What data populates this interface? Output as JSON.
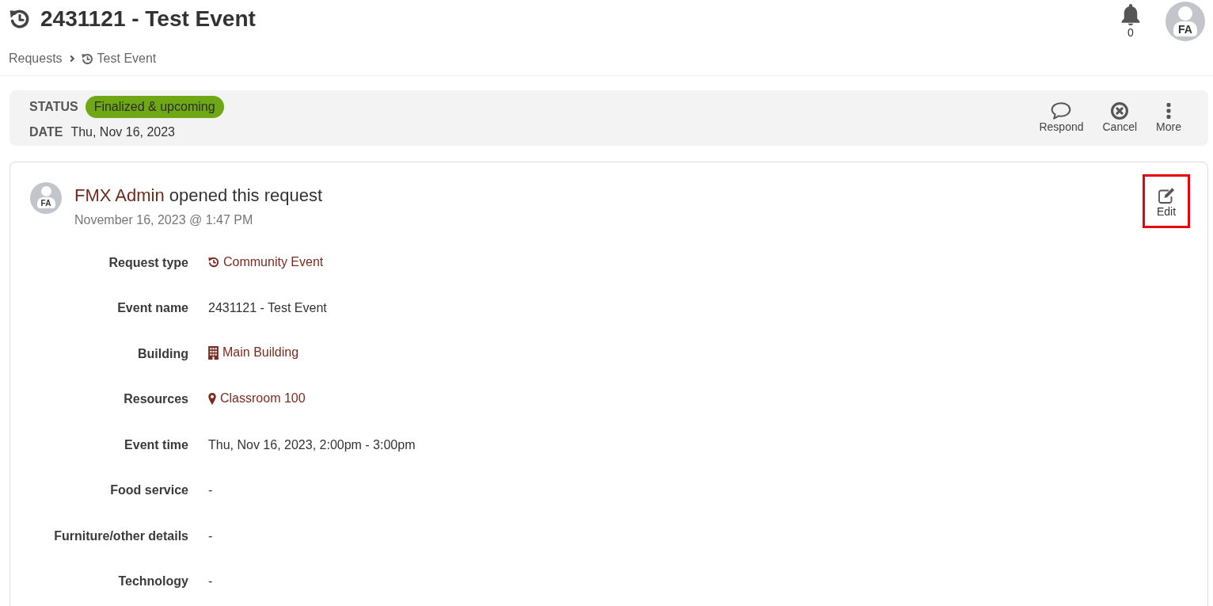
{
  "header": {
    "title": "2431121 - Test Event",
    "notification_count": "0",
    "avatar_initials": "FA"
  },
  "breadcrumb": [
    {
      "label": "Requests",
      "kind": "link"
    },
    {
      "label": "Test Event",
      "kind": "event"
    }
  ],
  "summary": {
    "status_label": "STATUS",
    "status": "Finalized & upcoming",
    "date_label": "DATE",
    "date": "Thu, Nov 16, 2023",
    "actions": [
      {
        "label": "Respond",
        "kind": "respond"
      },
      {
        "label": "Cancel",
        "kind": "cancel"
      },
      {
        "label": "More",
        "kind": "more"
      }
    ]
  },
  "activity": {
    "avatar_initials": "FA",
    "actor": "FMX Admin",
    "action": "opened this request",
    "timestamp": "November 16, 2023 @ 1:47 PM",
    "edit": {
      "label": "Edit",
      "highlighted": true
    },
    "fields": [
      {
        "label": "Request type",
        "value": "Community Event",
        "kind": "event"
      },
      {
        "label": "Event name",
        "value": "2431121 - Test Event",
        "kind": "text"
      },
      {
        "label": "Building",
        "value": "Main Building",
        "kind": "building"
      },
      {
        "label": "Resources",
        "value": "Classroom 100",
        "kind": "location"
      },
      {
        "label": "Event time",
        "value": "Thu, Nov 16, 2023, 2:00pm - 3:00pm",
        "kind": "text"
      },
      {
        "label": "Food service",
        "value": "-",
        "kind": "text"
      },
      {
        "label": "Furniture/other details",
        "value": "-",
        "kind": "text"
      },
      {
        "label": "Technology",
        "value": "-",
        "kind": "text"
      }
    ]
  }
}
